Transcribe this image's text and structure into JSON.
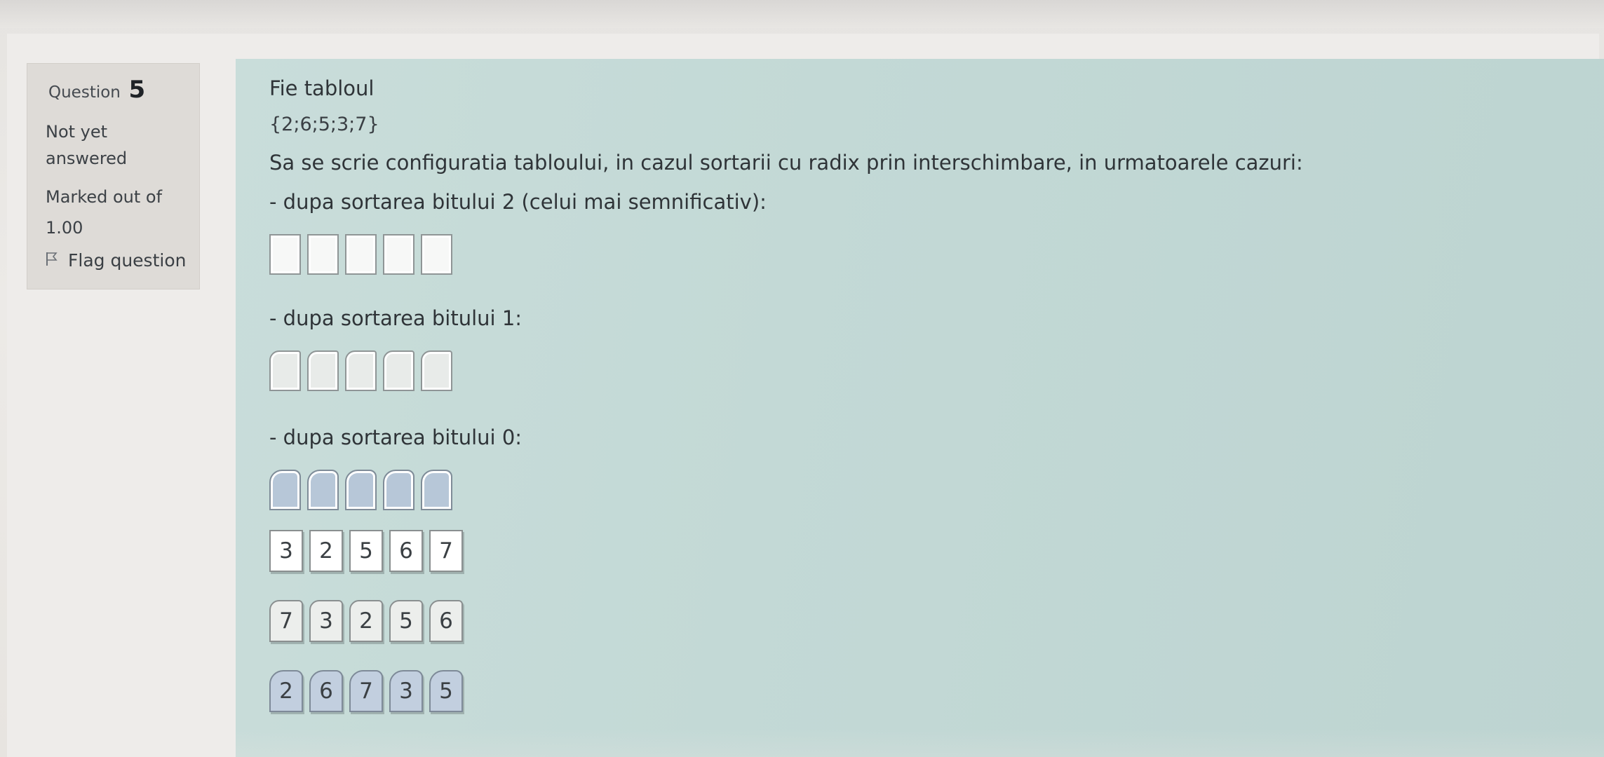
{
  "question": {
    "label": "Question",
    "number": "5",
    "state": "Not yet answered",
    "grade": "Marked out of 1.00",
    "flag_label": "Flag question"
  },
  "content": {
    "line1": "Fie tabloul",
    "array": "{2;6;5;3;7}",
    "instruction": "Sa se scrie configuratia tabloului, in cazul sortarii cu radix prin interschimbare, in urmatoarele cazuri:",
    "step2": "- dupa sortarea bitului 2 (celui mai semnificativ):",
    "step1": "- dupa sortarea bitului 1:",
    "step0": "- dupa sortarea bitului 0:"
  },
  "drag_groups": [
    [
      "3",
      "2",
      "5",
      "6",
      "7"
    ],
    [
      "7",
      "3",
      "2",
      "5",
      "6"
    ],
    [
      "2",
      "6",
      "7",
      "3",
      "5"
    ]
  ]
}
